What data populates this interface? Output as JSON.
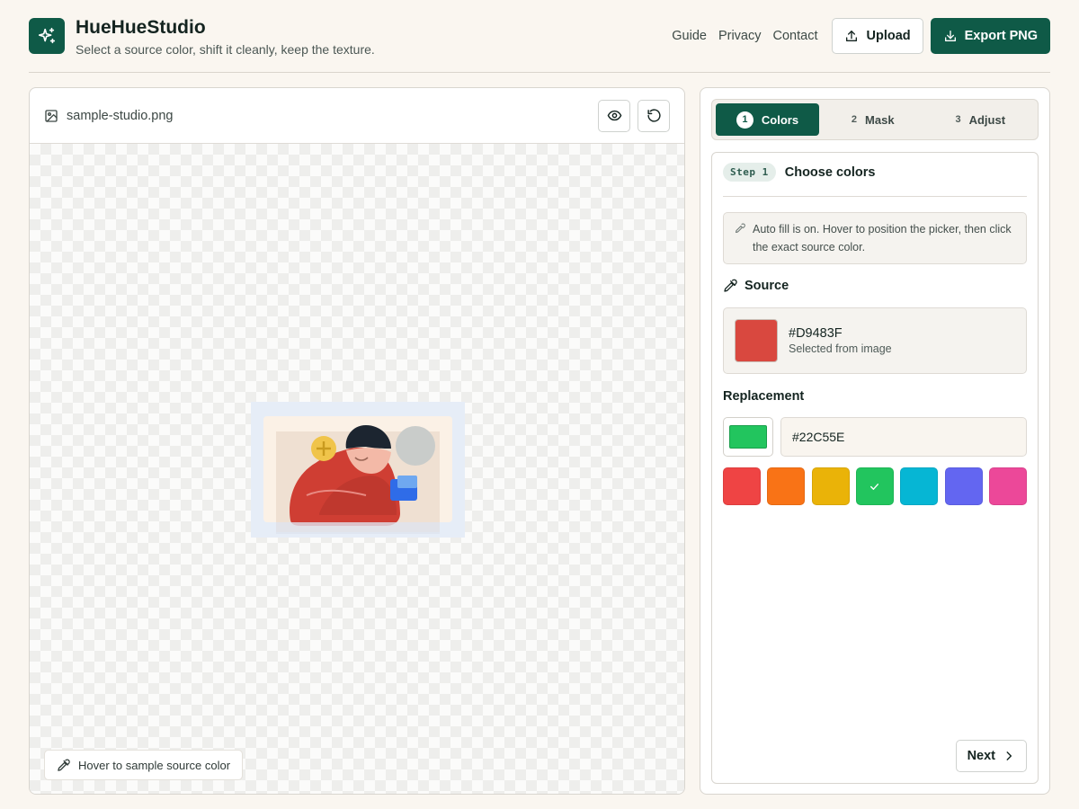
{
  "app": {
    "title": "HueHueStudio",
    "subtitle": "Select a source color, shift it cleanly, keep the texture."
  },
  "nav": {
    "links": [
      "Guide",
      "Privacy",
      "Contact"
    ],
    "upload_label": "Upload",
    "export_label": "Export PNG"
  },
  "canvas": {
    "filename": "sample-studio.png",
    "hint": "Hover to sample source color"
  },
  "steps": [
    {
      "num": "1",
      "label": "Colors",
      "active": true
    },
    {
      "num": "2",
      "label": "Mask",
      "active": false
    },
    {
      "num": "3",
      "label": "Adjust",
      "active": false
    }
  ],
  "step_card": {
    "tag": "Step 1",
    "title": "Choose colors",
    "info": "Auto fill is on. Hover to position the picker, then click the exact source color.",
    "source_label": "Source",
    "source_hex": "#D9483F",
    "source_desc": "Selected from image",
    "replacement_label": "Replacement",
    "replacement_hex": "#22C55E",
    "next_label": "Next"
  },
  "palette": [
    {
      "color": "#EF4444",
      "selected": false
    },
    {
      "color": "#F97316",
      "selected": false
    },
    {
      "color": "#EAB308",
      "selected": false
    },
    {
      "color": "#22C55E",
      "selected": true
    },
    {
      "color": "#06B6D4",
      "selected": false
    },
    {
      "color": "#6366F1",
      "selected": false
    },
    {
      "color": "#EC4899",
      "selected": false
    }
  ],
  "colors": {
    "brand": "#0F5A47",
    "background": "#FAF6F0",
    "source": "#D9483F",
    "replacement": "#22C55E"
  },
  "icons": {
    "logo": "sparkles-icon",
    "upload": "upload-icon",
    "export": "download-icon",
    "file": "image-file-icon",
    "preview": "eye-icon",
    "reset": "rotate-ccw-icon",
    "picker": "eyedropper-icon",
    "next": "chevron-right-icon",
    "check": "check-icon"
  }
}
